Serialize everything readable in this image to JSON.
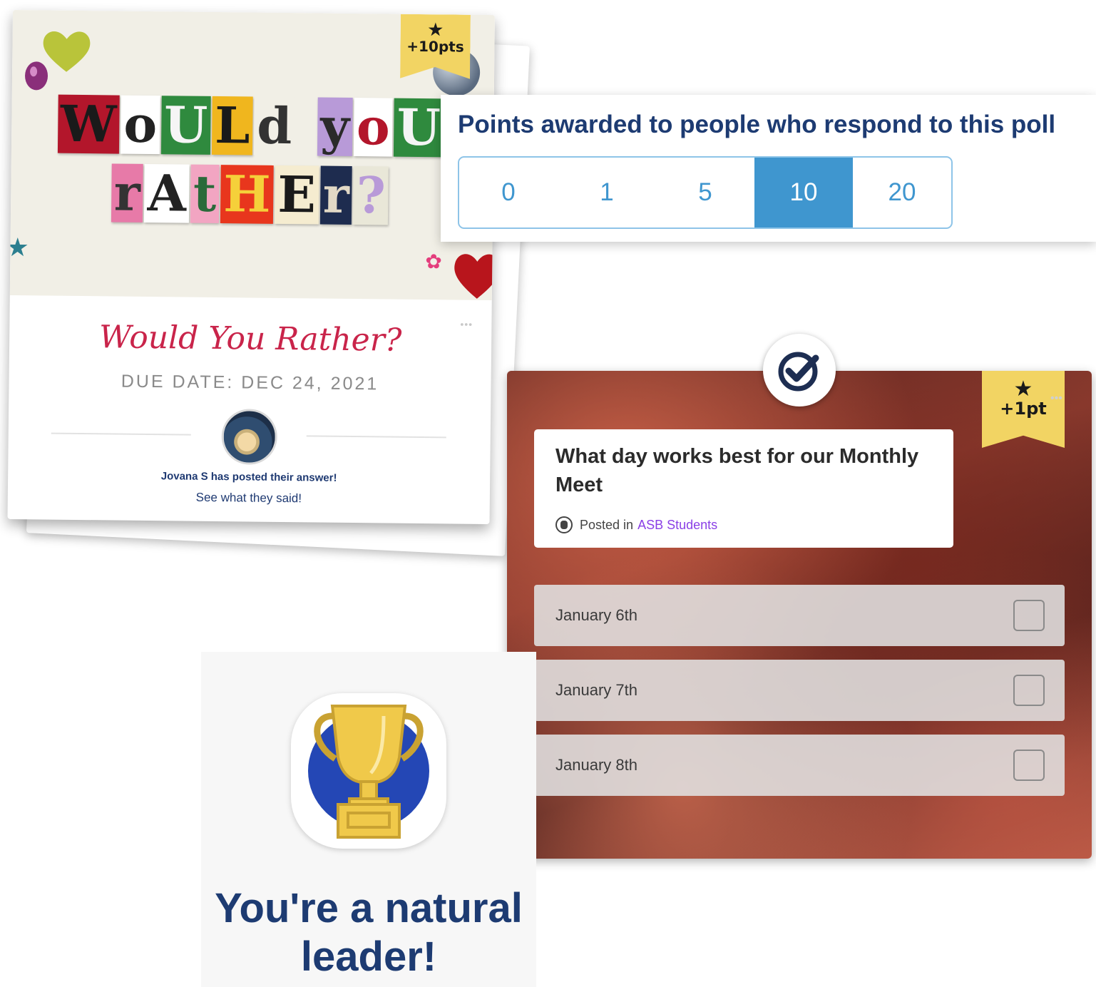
{
  "would_you_rather": {
    "cover_title_line1": [
      "W",
      "o",
      "U",
      "L",
      "d",
      " ",
      "y",
      "o",
      "U"
    ],
    "cover_title_line2": [
      "r",
      "A",
      "t",
      "H",
      "E",
      "r",
      "?"
    ],
    "badge": "+10pts",
    "title": "Would You Rather?",
    "due_date": "DUE DATE: DEC 24, 2021",
    "posted_text": "Jovana S has posted their answer!",
    "see_link": "See what they said!"
  },
  "points": {
    "title": "Points awarded to people who respond to this poll",
    "options": [
      "0",
      "1",
      "5",
      "10",
      "20"
    ],
    "selected": "10",
    "accent_color": "#3f96cf"
  },
  "poll": {
    "badge": "+1pt",
    "question": "What day works best for our Monthly Meet",
    "posted_prefix": "Posted in",
    "group": "ASB Students",
    "options": [
      "January 6th",
      "January 7th",
      "January 8th"
    ]
  },
  "achievement": {
    "message": "You're a natural leader!",
    "icon": "trophy-icon"
  }
}
